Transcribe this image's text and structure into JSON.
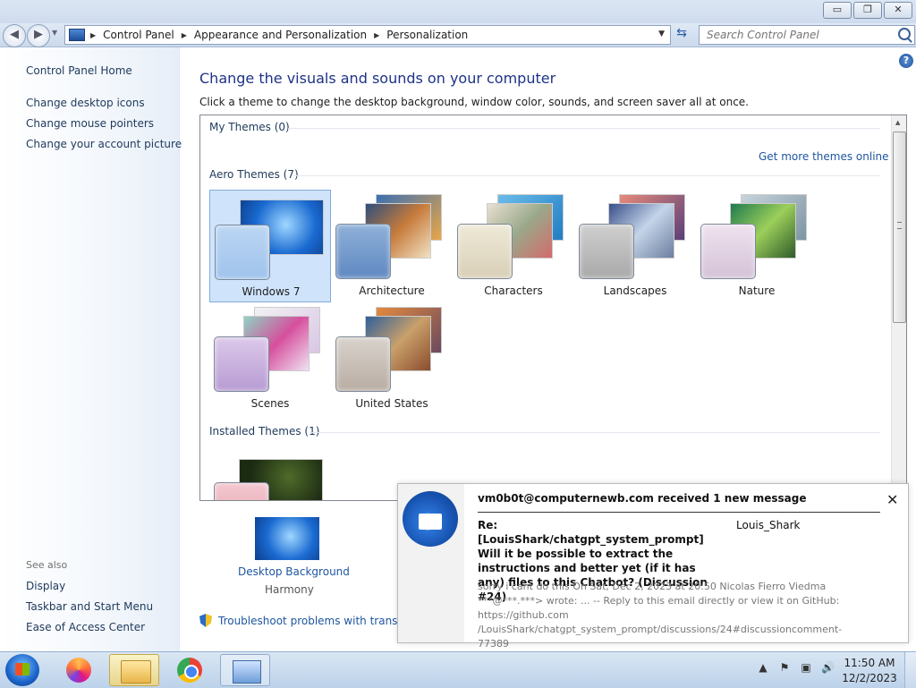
{
  "window": {
    "minimize": "▭",
    "maximize": "❐",
    "close": "✕"
  },
  "address": {
    "crumbs": [
      "Control Panel",
      "Appearance and Personalization",
      "Personalization"
    ],
    "search_placeholder": "Search Control Panel"
  },
  "left_pane": {
    "home": "Control Panel Home",
    "links": [
      "Change desktop icons",
      "Change mouse pointers",
      "Change your account picture"
    ],
    "see_also_title": "See also",
    "see_also": [
      "Display",
      "Taskbar and Start Menu",
      "Ease of Access Center"
    ]
  },
  "main": {
    "heading": "Change the visuals and sounds on your computer",
    "subtitle": "Click a theme to change the desktop background, window color, sounds, and screen saver all at once.",
    "my_themes": "My Themes (0)",
    "get_more": "Get more themes online",
    "aero_themes": "Aero Themes (7)",
    "installed_themes": "Installed Themes (1)",
    "themes": [
      "Windows 7",
      "Architecture",
      "Characters",
      "Landscapes",
      "Nature",
      "Scenes",
      "United States"
    ],
    "selected_theme": "Windows 7",
    "desktop_background_label": "Desktop Background",
    "desktop_background_value": "Harmony",
    "troubleshoot": "Troubleshoot problems with transpare"
  },
  "notification": {
    "title": "vm0b0t@computernewb.com received 1 new message",
    "subject": "Re: [LouisShark/chatgpt_system_prompt] Will it be possible to extract the instructions and better yet (if it has any) files to this Chatbot? (Discussion #24)",
    "from": "Louis_Shark",
    "body": "sorry i cant do this On Sat, Dec 2, 2023 at 20:50 Nicolas Fierro Viedma ***@***.***> wrote: ... -- Reply to this email directly or view it on GitHub: https://github.com /LouisShark/chatgpt_system_prompt/discussions/24#discussioncomment-77389"
  },
  "taskbar": {
    "time": "11:50 AM",
    "date": "12/2/2023"
  }
}
